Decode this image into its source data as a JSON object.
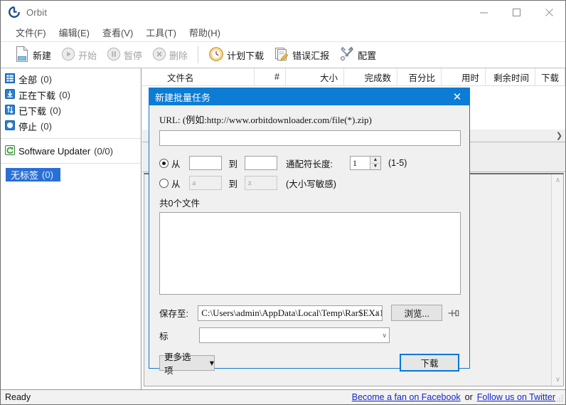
{
  "window": {
    "title": "Orbit",
    "icon": "orbit-logo-icon",
    "minimize_label": "─",
    "maximize_label": "□",
    "close_label": "✕"
  },
  "menubar": {
    "items": [
      {
        "label": "文件(F)",
        "name": "menu-file"
      },
      {
        "label": "编辑(E)",
        "name": "menu-edit"
      },
      {
        "label": "查看(V)",
        "name": "menu-view"
      },
      {
        "label": "工具(T)",
        "name": "menu-tools"
      },
      {
        "label": "帮助(H)",
        "name": "menu-help"
      }
    ]
  },
  "toolbar": {
    "buttons": [
      {
        "label": "新建",
        "icon": "new-document-icon",
        "disabled": false
      },
      {
        "label": "开始",
        "icon": "play-icon",
        "disabled": true
      },
      {
        "label": "暂停",
        "icon": "pause-icon",
        "disabled": true
      },
      {
        "label": "删除",
        "icon": "delete-icon",
        "disabled": true
      },
      {
        "label": "计划下载",
        "icon": "clock-icon",
        "disabled": false
      },
      {
        "label": "错误汇报",
        "icon": "report-icon",
        "disabled": false
      },
      {
        "label": "配置",
        "icon": "tools-icon",
        "disabled": false
      }
    ]
  },
  "sidebar": {
    "items": [
      {
        "label": "全部",
        "count": "(0)",
        "icon": "list-all-icon",
        "name": "sidebar-item-all"
      },
      {
        "label": "正在下载",
        "count": "(0)",
        "icon": "downloading-icon",
        "name": "sidebar-item-downloading"
      },
      {
        "label": "已下载",
        "count": "(0)",
        "icon": "downloaded-icon",
        "name": "sidebar-item-downloaded"
      },
      {
        "label": "停止",
        "count": "(0)",
        "icon": "stopped-icon",
        "name": "sidebar-item-stopped"
      }
    ],
    "updater": {
      "label": "Software Updater",
      "count": "(0/0)",
      "icon": "software-updater-icon"
    },
    "tag": {
      "label": "无标签",
      "count": "(0)"
    }
  },
  "list": {
    "columns": [
      {
        "label": "文件名",
        "width": 158
      },
      {
        "label": "#",
        "width": 44
      },
      {
        "label": "大小",
        "width": 82
      },
      {
        "label": "完成数",
        "width": 75
      },
      {
        "label": "百分比",
        "width": 62
      },
      {
        "label": "用时",
        "width": 62
      },
      {
        "label": "剩余时间",
        "width": 70
      },
      {
        "label": "下载",
        "width": 42
      }
    ],
    "hscroll_arrow": "❯",
    "vscroll_up": "∧",
    "vscroll_down": "∨"
  },
  "statusbar": {
    "status": "Ready",
    "facebook_link": "Become a fan on Facebook",
    "separator": "or",
    "twitter_link": "Follow us on Twitter"
  },
  "dialog": {
    "title": "新建批量任务",
    "close_label": "✕",
    "url_label": "URL: (例如:http://www.orbitdownloader.com/file(*).zip)",
    "url_value": "",
    "url_placeholder": "",
    "range_numeric": {
      "selected": true,
      "from_label": "从",
      "from_value": "",
      "to_label": "到",
      "to_value": "",
      "wildcard_label": "通配符长度:",
      "wildcard_value": "1",
      "wildcard_hint": "(1-5)"
    },
    "range_alpha": {
      "selected": false,
      "from_label": "从",
      "from_value": "a",
      "to_label": "到",
      "to_value": "z",
      "hint": "(大小写敏感)"
    },
    "file_count": "共0个文件",
    "file_list": [],
    "save_label": "保存至:",
    "save_path": "C:\\Users\\admin\\AppData\\Local\\Temp\\Rar$EXa1",
    "browse_label": "浏览...",
    "pin_icon": "pin-icon",
    "tag_label": "标",
    "tag_value": "",
    "more_label": "更多选项",
    "more_arrow": "▾",
    "download_label": "下载",
    "combo_arrow": "∨"
  },
  "colors": {
    "accent": "#0c7cd5",
    "selection": "#2a6fd6",
    "link": "#1326c9",
    "dialog_border": "#1277d4"
  }
}
